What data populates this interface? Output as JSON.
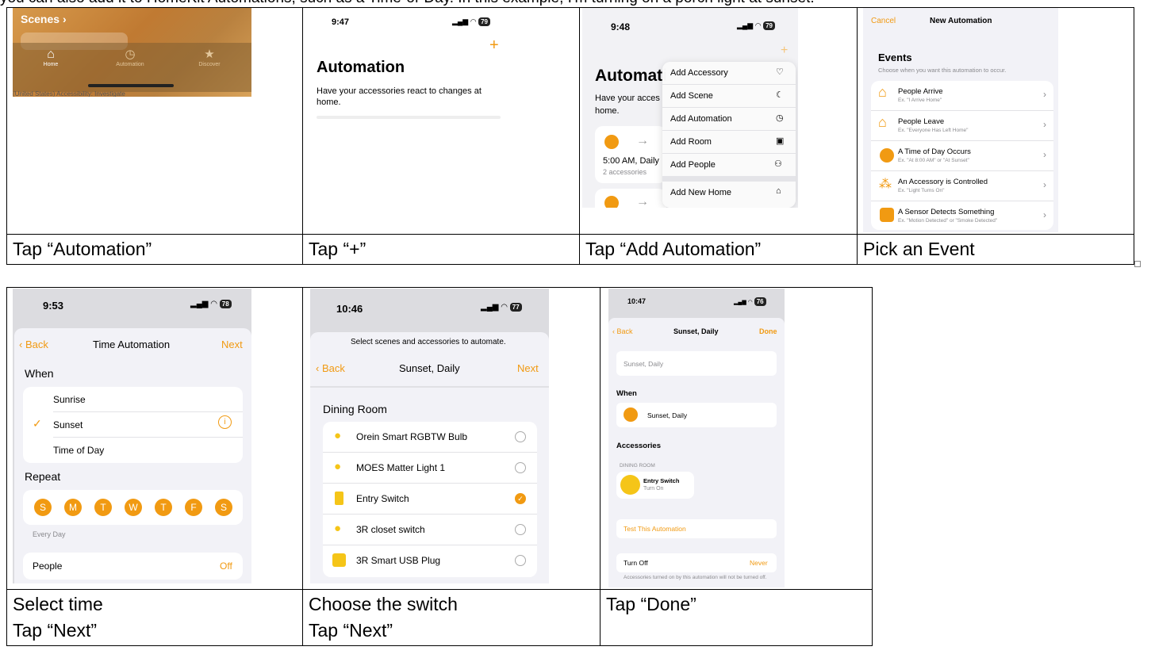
{
  "intro_text": "you can also add it to HomeKit Automations, such as a Time-of-Day. In this example, I'm turning on a porch light at sunset:",
  "row1": {
    "captions": [
      "Tap “Automation”",
      "Tap “+”",
      "Tap “Add Automation”",
      "Pick an Event"
    ],
    "s1": {
      "title": "Scenes",
      "tabs": [
        "Home",
        "Automation",
        "Discover"
      ],
      "bottom_text": "(United States)  Accessibility: Investigate"
    },
    "s2": {
      "time": "9:47",
      "battery": "79",
      "plus": "+",
      "title": "Automation",
      "desc": "Have your accessories react to changes at home."
    },
    "s3": {
      "time": "9:48",
      "battery": "79",
      "title": "Automati",
      "desc_a": "Have your acces",
      "desc_b": "home.",
      "menu": [
        "Add Accessory",
        "Add Scene",
        "Add Automation",
        "Add Room",
        "Add People",
        "Add New Home"
      ],
      "card_title": "5:00 AM, Daily",
      "card_sub": "2 accessories"
    },
    "s4": {
      "cancel": "Cancel",
      "title": "New Automation",
      "heading": "Events",
      "sub": "Choose when you want this automation to occur.",
      "events": [
        {
          "title": "People Arrive",
          "ex": "Ex. \"I Arrive Home\""
        },
        {
          "title": "People Leave",
          "ex": "Ex. \"Everyone Has Left Home\""
        },
        {
          "title": "A Time of Day Occurs",
          "ex": "Ex. \"At 8:00 AM\" or \"At Sunset\""
        },
        {
          "title": "An Accessory is Controlled",
          "ex": "Ex. \"Light Turns On\""
        },
        {
          "title": "A Sensor Detects Something",
          "ex": "Ex. \"Motion Detected\" or \"Smoke Detected\""
        }
      ]
    }
  },
  "row2": {
    "captions": [
      [
        "Select time",
        "Tap “Next”"
      ],
      [
        "Choose the switch",
        "Tap “Next”"
      ],
      [
        "Tap “Done”"
      ]
    ],
    "s5": {
      "time": "9:53",
      "battery": "78",
      "back": "Back",
      "title": "Time Automation",
      "next": "Next",
      "when": "When",
      "options": [
        "Sunrise",
        "Sunset",
        "Time of Day"
      ],
      "repeat": "Repeat",
      "days": [
        "S",
        "M",
        "T",
        "W",
        "T",
        "F",
        "S"
      ],
      "every_day": "Every Day",
      "people": "People",
      "people_value": "Off"
    },
    "s6": {
      "time": "10:46",
      "battery": "77",
      "hint": "Select scenes and accessories to automate.",
      "back": "Back",
      "title": "Sunset, Daily",
      "next": "Next",
      "room": "Dining Room",
      "items": [
        "Orein Smart RGBTW Bulb",
        "MOES Matter Light 1",
        "Entry Switch",
        "3R closet switch",
        "3R Smart USB Plug"
      ]
    },
    "s7": {
      "time": "10:47",
      "battery": "76",
      "back": "Back",
      "title": "Sunset, Daily",
      "done": "Done",
      "name_placeholder": "Sunset, Daily",
      "when": "When",
      "when_value": "Sunset, Daily",
      "accessories": "Accessories",
      "room": "DINING ROOM",
      "acc_name": "Entry Switch",
      "acc_state": "Turn On",
      "test": "Test This Automation",
      "turn_off": "Turn Off",
      "turn_off_value": "Never",
      "footnote": "Accessories turned on by this automation will not be turned off."
    }
  },
  "colors": {
    "accent": "#f19a12",
    "bg": "#f2f2f7"
  }
}
